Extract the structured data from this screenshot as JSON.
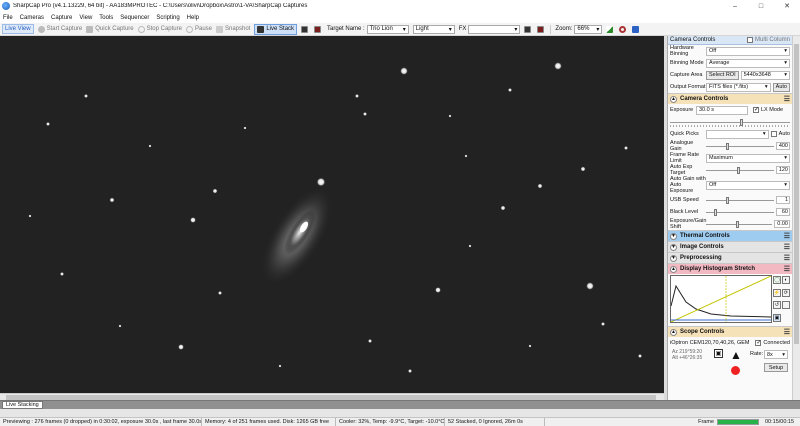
{
  "window": {
    "title": "SharpCap Pro (v4.1.13229, 64 bit) - AA183MPROTEC - C:\\Users\\olivi\\Dropbox\\Astro\\1-VA\\SharpCap Captures",
    "minimize": "–",
    "maximize": "□",
    "close": "✕"
  },
  "menu": [
    "File",
    "Cameras",
    "Capture",
    "View",
    "Tools",
    "Sequencer",
    "Scripting",
    "Help"
  ],
  "toolbar": {
    "live_view": "Live View",
    "start_capture": "Start Capture",
    "quick_capture": "Quick Capture",
    "stop_capture": "Stop Capture",
    "pause": "Pause",
    "snapshot": "Snapshot",
    "live_stack": "Live Stack",
    "target_label": "Target Name :",
    "target_value": "Trio Lion",
    "light_value": "Light",
    "fx_label": "FX",
    "fx_value": "",
    "zoom_label": "Zoom:",
    "zoom_value": "66%"
  },
  "panel": {
    "header": "Camera Controls",
    "multi_column": "Multi Column",
    "rows_top": [
      {
        "label": "Hardware Binning",
        "value": "Off"
      },
      {
        "label": "Binning Mode",
        "value": "Average"
      },
      {
        "label": "Capture Area",
        "button": "Select ROI",
        "value": "5440x3648"
      },
      {
        "label": "Output Format",
        "value": "FITS files (*.fits)",
        "button": "Auto"
      }
    ],
    "camera_controls": {
      "title": "Camera Controls",
      "exposure_label": "Exposure",
      "exposure_value": "30.0 s",
      "lx_mode": "LX Mode",
      "quick_picks_label": "Quick Picks",
      "auto_label": "Auto",
      "analogue_gain_label": "Analogue Gain",
      "analogue_gain_value": "400",
      "frame_rate_label": "Frame Rate Limit",
      "frame_rate_value": "Maximum",
      "auto_exp_label": "Auto Exp Target",
      "auto_exp_value": "120",
      "auto_gain_label": "Auto Gain with Auto Exposure",
      "auto_gain_value": "Off",
      "usb_speed_label": "USB Speed",
      "usb_speed_value": "1",
      "black_level_label": "Black Level",
      "black_level_value": "60",
      "exposure_gain_label": "Exposure/Gain Shift",
      "exposure_gain_value": "0.00"
    },
    "sections": {
      "thermal": "Thermal Controls",
      "image": "Image Controls",
      "preprocessing": "Preprocessing",
      "histogram": "Display Histogram Stretch",
      "scope": "Scope Controls"
    },
    "scope": {
      "mount": "iOptron CEM120,70,40,26, GEM",
      "connected": "Connected",
      "rate_label": "Rate:",
      "rate_value": "8x",
      "setup": "Setup",
      "az": "Az",
      "alt": "Alt",
      "az_value": "219°59:20",
      "alt_value": "+46°26:35"
    }
  },
  "status": {
    "tab": "Live Stacking",
    "previewing": "Previewing : 276 frames (0 dropped) in 0:30:02, exposure 30.0s , last frame 30.0s",
    "memory": "Memory: 4 of 251 frames used. Disk: 1265 GB free",
    "cooler": "Cooler: 32%, Temp: -9.9°C, Target: -10.0°C",
    "stacked": "52 Stacked, 0 Ignored, 26m 0s",
    "frame_label": "Frame",
    "frame_progress": 1.0,
    "time": "00:15/00:15"
  },
  "colors": {
    "accent": "#2a62c6",
    "camera_section": "#f6e2b8",
    "thermal_section": "#9ecbf0",
    "histogram_section": "#f2b9c2",
    "progress": "#27b34a"
  },
  "icons": {
    "live_view": "eye-icon",
    "start_capture": "record-icon",
    "quick_capture": "quick-capture-icon",
    "stop_capture": "stop-icon",
    "pause": "pause-icon",
    "snapshot": "snapshot-icon",
    "live_stack": "live-stack-icon"
  }
}
